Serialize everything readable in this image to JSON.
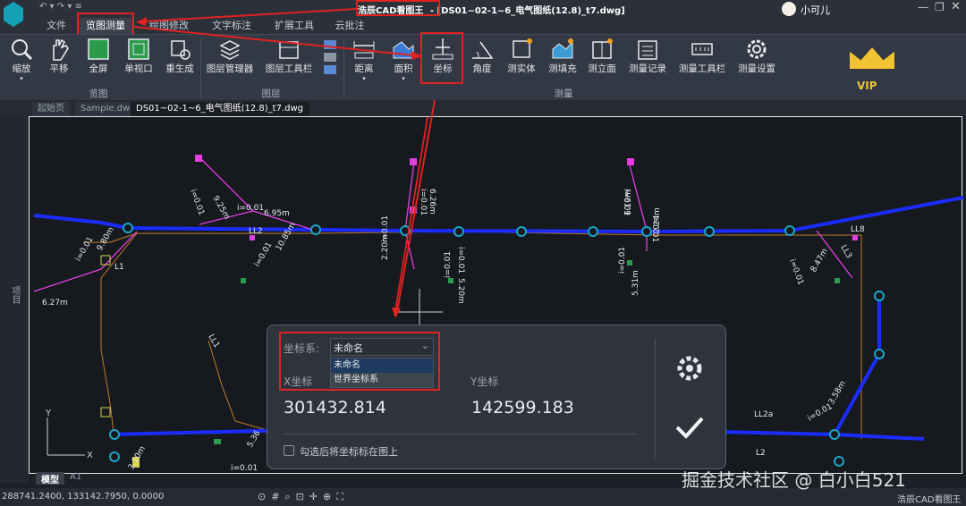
{
  "title": {
    "app": "浩辰CAD看图王",
    "file": "- [DS01~02-1~6_电气图纸(12.8)_t7.dwg]",
    "user": "小可儿"
  },
  "menu": [
    "文件",
    "览图测量",
    "绘图修改",
    "文字标注",
    "扩展工具",
    "云批注"
  ],
  "ribbon": {
    "view": [
      "缩放",
      "平移",
      "全屏",
      "单视口",
      "重生成"
    ],
    "layer": [
      "图层管理器",
      "图层工具栏"
    ],
    "measure": [
      "距离",
      "面积",
      "坐标",
      "角度",
      "测实体",
      "测填充",
      "测立面",
      "测量记录",
      "测量工具栏",
      "测量设置"
    ],
    "groups": [
      "览图",
      "图层",
      "测量"
    ],
    "vip": "VIP"
  },
  "tabs": [
    "起始页",
    "Sample.dwg",
    "DS01~02-1~6_电气图纸(12.8)_t7.dwg"
  ],
  "side": "项目",
  "drawing": {
    "labels": [
      "i=0.01",
      "9.25m",
      "i=0.01",
      "6.95m",
      "i=0.01",
      "10.85m",
      "9.80m",
      "i=0.01",
      "6.27m",
      "i=0.01",
      "i=0.01",
      "2.20m",
      "i=0.01",
      "6.26m",
      "i=0.01",
      "5.20m",
      "i=0.01",
      "6.19m",
      "i=0.01",
      "2.24m",
      "i=0.01",
      "5.31m",
      "i=0.01",
      "8.47m",
      "LL8",
      "LL3",
      "L1",
      "LL2",
      "LL1",
      "LL2a",
      "L2",
      "i=0.01",
      "3.58m",
      "5.36",
      "3.10m",
      "i=0.01"
    ],
    "ucs_y": "Y",
    "ucs_x": "X",
    "model_tab": "模型",
    "layout_tab": "A1"
  },
  "dialog": {
    "cs_label": "坐标系:",
    "cs_value": "未命名",
    "options": [
      "未命名",
      "世界坐标系"
    ],
    "x_label": "X坐标",
    "y_label": "Y坐标",
    "x_value": "301432.814",
    "y_value": "142599.183",
    "checkbox": "勾选后将坐标标在图上"
  },
  "status": {
    "coords": "288741.2400, 133142.7950, 0.0000",
    "brand": "浩辰CAD看图王"
  },
  "watermark": "掘金技术社区 @ 白小白521"
}
